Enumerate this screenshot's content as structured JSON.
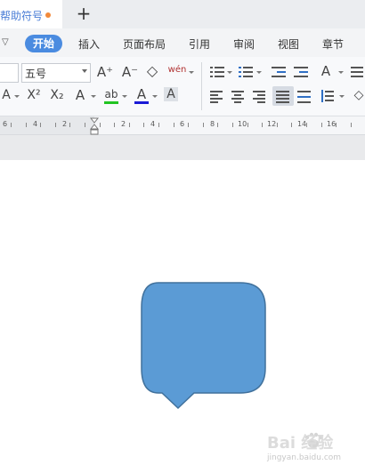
{
  "tab": {
    "title": "帮助符号",
    "new_tab": "+"
  },
  "menu": {
    "chevron": "▽",
    "items": [
      "开始",
      "插入",
      "页面布局",
      "引用",
      "审阅",
      "视图",
      "章节"
    ]
  },
  "ribbon": {
    "font_size": "五号",
    "grow_font": "A⁺",
    "shrink_font": "A⁻",
    "clear_format": "◇",
    "phonetic": "wén",
    "superscript": "X²",
    "subscript": "X₂",
    "text_effect": "A",
    "highlight": "ab",
    "font_color": "A",
    "char_shading": "A",
    "highlight_color": "#22c422",
    "font_color_bar": "#1a1ad6"
  },
  "ruler": {
    "numbers": [
      "6",
      "4",
      "2",
      "2",
      "4",
      "6",
      "8",
      "10",
      "12",
      "14",
      "16"
    ]
  },
  "shape": {
    "fill": "#5b9bd5",
    "stroke": "#41719c",
    "kind": "rounded-rectangle-callout"
  },
  "watermark": {
    "brand": "Bai 经验",
    "url": "jingyan.baidu.com"
  }
}
